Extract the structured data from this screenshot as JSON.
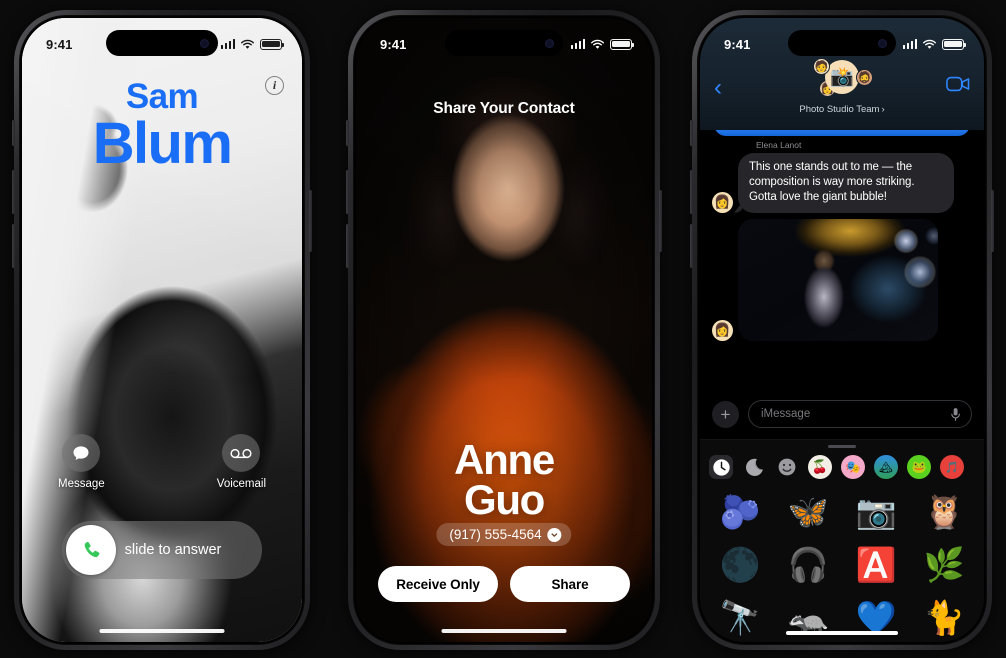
{
  "colors": {
    "ios_blue": "#1a6ef5",
    "imessage_blue": "#2f86ff",
    "green": "#35c759",
    "white": "#ffffff",
    "background": "#0b0b0c"
  },
  "phone1": {
    "status": {
      "time": "9:41",
      "cellular": "signal-bars",
      "wifi": "wifi",
      "battery": "battery-full"
    },
    "caller": {
      "first_name": "Sam",
      "last_name": "Blum"
    },
    "info_button": "i",
    "actions": [
      {
        "label": "Message",
        "icon": "message-bubble-icon"
      },
      {
        "label": "Voicemail",
        "icon": "voicemail-icon"
      }
    ],
    "slider": {
      "label": "slide to answer",
      "icon": "phone-handset-icon"
    }
  },
  "phone2": {
    "status": {
      "time": "9:41"
    },
    "title": "Share Your Contact",
    "contact": {
      "first_name": "Anne",
      "last_name": "Guo",
      "phone": "(917) 555-4564"
    },
    "buttons": {
      "secondary": "Receive Only",
      "primary": "Share"
    }
  },
  "phone3": {
    "status": {
      "time": "9:41"
    },
    "nav": {
      "back": "‹",
      "group_name": "Photo Studio Team",
      "chevron": "›",
      "video_icon": "facetime-video-icon",
      "group_avatar_emoji": "📸"
    },
    "message": {
      "sender": "Elena Lanot",
      "text": "This one stands out to me — the composition is way more striking. Gotta love the giant bubble!",
      "avatar_emoji": "👩",
      "attachment_alt": "photo-bubbles-portrait",
      "download_icon": "save-to-photos-icon"
    },
    "input": {
      "placeholder": "iMessage",
      "plus": "+",
      "mic_icon": "microphone-icon"
    },
    "drawer": {
      "tabs": [
        {
          "name": "recents-tab",
          "glyph": "🕓",
          "selected": true
        },
        {
          "name": "stickers-tab",
          "glyph": "🌙",
          "selected": false
        },
        {
          "name": "emoji-tab",
          "glyph": "🙂",
          "selected": false
        },
        {
          "name": "photos-app-tab",
          "glyph": "🍒",
          "selected": false
        },
        {
          "name": "memoji-app-tab",
          "glyph": "🎭",
          "selected": false
        },
        {
          "name": "weather-app-tab",
          "glyph": "🏔",
          "selected": false
        },
        {
          "name": "duolingo-app-tab",
          "glyph": "🐸",
          "selected": false
        },
        {
          "name": "music-app-tab",
          "glyph": "🎵",
          "selected": false
        }
      ],
      "stickers": [
        "🫐",
        "🦋",
        "📷",
        "🦉",
        "🌑",
        "🎧",
        "🅰️",
        "🌿",
        "🔭",
        "🦡",
        "💙",
        "🐈"
      ]
    }
  }
}
